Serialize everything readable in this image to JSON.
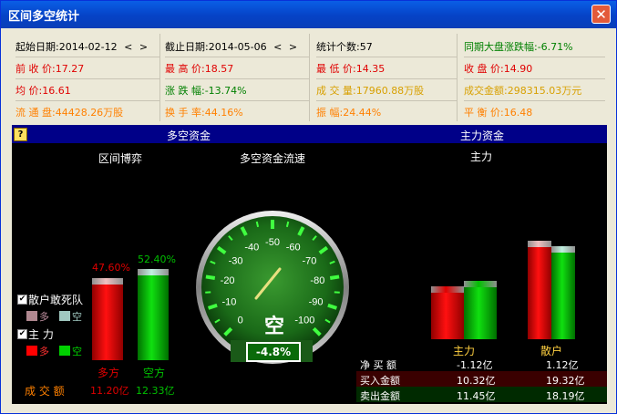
{
  "window": {
    "title": "区间多空统计",
    "close_glyph": "✕"
  },
  "stats": {
    "row1": {
      "start_date": "起始日期:2014-02-12",
      "end_date": "截止日期:2014-05-06",
      "count": "统计个数:57",
      "market_change": "同期大盘涨跌幅:-6.71%"
    },
    "nav": {
      "prev": "<",
      "next": ">"
    },
    "row2": {
      "a": "前 收 价:17.27",
      "b": "最 高 价:18.57",
      "c": "最 低 价:14.35",
      "d": "收 盘 价:14.90"
    },
    "row3": {
      "a": "均    价:16.61",
      "b": "涨 跌 幅:-13.74%",
      "c": "成 交 量:17960.88万股",
      "d": "成交金额:298315.03万元"
    },
    "row4": {
      "a": "流 通 盘:44428.26万股",
      "b": "换 手 率:44.16%",
      "c": "振    幅:24.44%",
      "d": "平 衡 价:16.48"
    }
  },
  "panel": {
    "help": "?",
    "header_left": "多空资金",
    "header_right": "主力资金",
    "sub_left": "区间博弈",
    "sub_mid": "多空资金流速",
    "sub_right": "主力"
  },
  "left": {
    "bull_pct": "47.60%",
    "bear_pct": "52.40%",
    "bull_value": 47.6,
    "bear_value": 52.4,
    "bull_label": "多方",
    "bear_label": "空方",
    "turnover_label": "成  交  额",
    "bull_amount": "11.20亿",
    "bear_amount": "12.33亿",
    "legend": {
      "retail_title": "散户敢死队",
      "main_title": "主    力",
      "bull": "多",
      "bear": "空",
      "check": "✔"
    }
  },
  "gauge": {
    "ticks": [
      "0",
      "-10",
      "-20",
      "-30",
      "-40",
      "-50",
      "-60",
      "-70",
      "-80",
      "-90",
      "-100"
    ],
    "center_text": "空",
    "readout": "-4.8%",
    "value": -4.8
  },
  "right": {
    "cat_main": "主力",
    "cat_retail": "散户",
    "rows": [
      {
        "label": "净 买 额",
        "main": "-1.12亿",
        "retail": "1.12亿"
      },
      {
        "label": "买入金额",
        "main": "10.32亿",
        "retail": "19.32亿"
      },
      {
        "label": "卖出金额",
        "main": "11.45亿",
        "retail": "18.19亿"
      }
    ],
    "main_buy": 10.32,
    "main_sell": 11.45,
    "retail_buy": 19.32,
    "retail_sell": 18.19
  },
  "colors": {
    "red": "#e00000",
    "green": "#00c000",
    "gold": "#d8a000",
    "orange": "#ff8000",
    "cyan": "#00e0e0"
  }
}
